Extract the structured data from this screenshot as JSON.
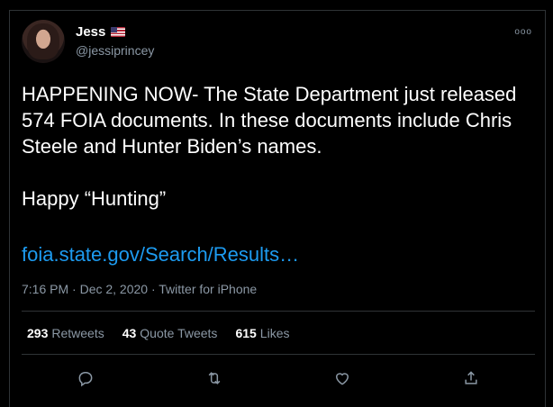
{
  "tweet": {
    "author_name": "Jess",
    "author_handle": "@jessiprincey",
    "flag_icon": "us-flag-icon",
    "more_icon": "ooo",
    "text": "HAPPENING NOW- The State Department just released 574 FOIA documents. In these documents include Chris Steele and Hunter Biden’s names.\n\nHappy “Hunting”",
    "link": "foia.state.gov/Search/Results…",
    "timestamp": "7:16 PM · Dec 2, 2020 · Twitter for iPhone"
  },
  "stats": {
    "retweets_count": "293",
    "retweets_label": "Retweets",
    "quote_count": "43",
    "quote_label": "Quote Tweets",
    "likes_count": "615",
    "likes_label": "Likes"
  },
  "colors": {
    "background": "#000000",
    "text": "#ffffff",
    "secondary": "#8b98a5",
    "link": "#1d9bf0",
    "border": "#2f3336"
  },
  "actions": [
    "reply-icon",
    "retweet-icon",
    "like-icon",
    "share-icon"
  ]
}
